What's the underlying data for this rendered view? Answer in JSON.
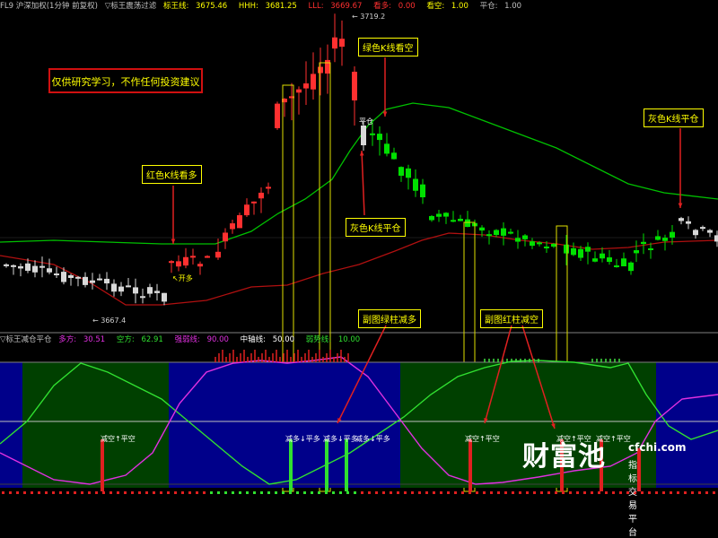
{
  "top_header": {
    "contract": "FL9 沪深加权(1分钟 前复权)",
    "indicator": "▽标王震荡过滤",
    "biaowang_label": "标王线:",
    "biaowang_value": "3675.46",
    "hhh_label": "HHH:",
    "hhh_value": "3681.25",
    "lll_label": "LLL:",
    "lll_value": "3669.67",
    "kanduo_label": "看多:",
    "kanduo_value": "0.00",
    "kankong_label": "看空:",
    "kankong_value": "1.00",
    "pingcang_label": "平仓:",
    "pingcang_value": "1.00"
  },
  "price_labels": {
    "high": "3719.2",
    "low": "3667.4"
  },
  "disclaimer": "仅供研究学习，不作任何投资建议",
  "annotations": {
    "red_long": "红色K线看多",
    "green_short": "绿色K线看空",
    "gray_flat_mid": "灰色K线平仓",
    "gray_flat_right": "灰色K线平仓",
    "sub_green_reduce": "副图绿柱减多",
    "sub_red_reduce": "副图红柱减空"
  },
  "signal_marks": {
    "kaiduo": "开多",
    "pingcang": "平仓"
  },
  "sub_header": {
    "indicator": "▽标王减仓平仓",
    "duofang_label": "多方:",
    "duofang_value": "30.51",
    "kongfang_label": "空方:",
    "kongfang_value": "62.91",
    "qiangruo_label": "强弱线:",
    "qiangruo_value": "90.00",
    "zhongzhou_label": "中轴线:",
    "zhongzhou_value": "50.00",
    "ruoshi_label": "弱势线:",
    "ruoshi_value": "10.00"
  },
  "sub_signals": [
    {
      "text": "减空↑平空"
    },
    {
      "text": "减多↓平多"
    },
    {
      "text": "减多↓平多"
    },
    {
      "text": "减多↓平多"
    },
    {
      "text": "减空↑平空"
    },
    {
      "text": "减空↑平空"
    },
    {
      "text": "减空↑平空"
    }
  ],
  "watermark": {
    "brand": "财富池",
    "url": "cfchi.com",
    "tagline": "指标交易平台"
  },
  "colors": {
    "bull": "#ff3030",
    "bear": "#00e000",
    "neutral": "#d8d8d8",
    "ma_green": "#00c000",
    "ma_red": "#b01010",
    "annotation": "#ffff00",
    "arrow": "#e02020",
    "sub_blue": "#00008a",
    "sub_green": "#004000",
    "dif_line": "#30e030",
    "dea_line": "#e030e0"
  }
}
